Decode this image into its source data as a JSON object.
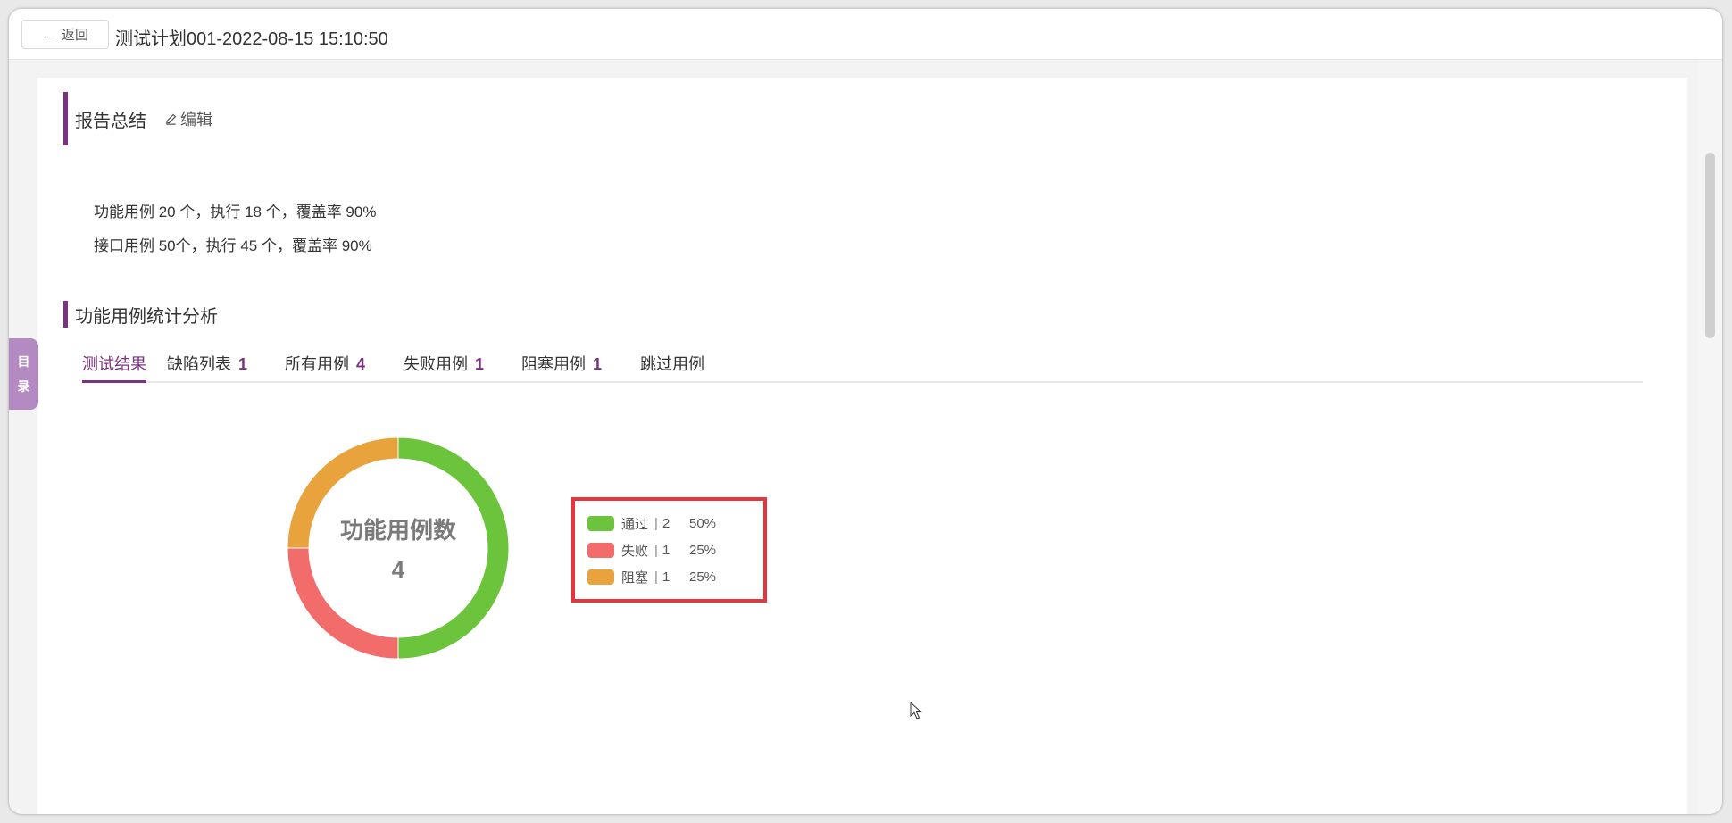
{
  "header": {
    "back_label": "返回",
    "title": "测试计划001-2022-08-15 15:10:50"
  },
  "report_summary": {
    "title": "报告总结",
    "edit_label": "编辑",
    "lines": [
      "功能用例 20 个，执行 18 个，覆盖率 90%",
      "接口用例 50个，执行 45 个，覆盖率 90%"
    ]
  },
  "analysis": {
    "title": "功能用例统计分析",
    "tabs": [
      {
        "label": "测试结果",
        "count": ""
      },
      {
        "label": "缺陷列表",
        "count": "1"
      },
      {
        "label": "所有用例",
        "count": "4"
      },
      {
        "label": "失败用例",
        "count": "1"
      },
      {
        "label": "阻塞用例",
        "count": "1"
      },
      {
        "label": "跳过用例",
        "count": ""
      }
    ]
  },
  "side_nav": {
    "chars": [
      "目",
      "录"
    ]
  },
  "chart_data": {
    "type": "pie",
    "title": "功能用例数",
    "total": "4",
    "categories": [
      "通过",
      "失败",
      "阻塞"
    ],
    "values": [
      2,
      1,
      1
    ],
    "percent_labels": [
      "50%",
      "25%",
      "25%"
    ],
    "colors": [
      "#6bc43b",
      "#f26c6c",
      "#e8a33d"
    ],
    "legend_position": "right",
    "donut": true
  },
  "icons": {
    "back": "arrow-left-icon",
    "edit": "pencil-icon"
  },
  "colors": {
    "accent": "#7b3283",
    "legend_highlight": "#e5363c"
  }
}
